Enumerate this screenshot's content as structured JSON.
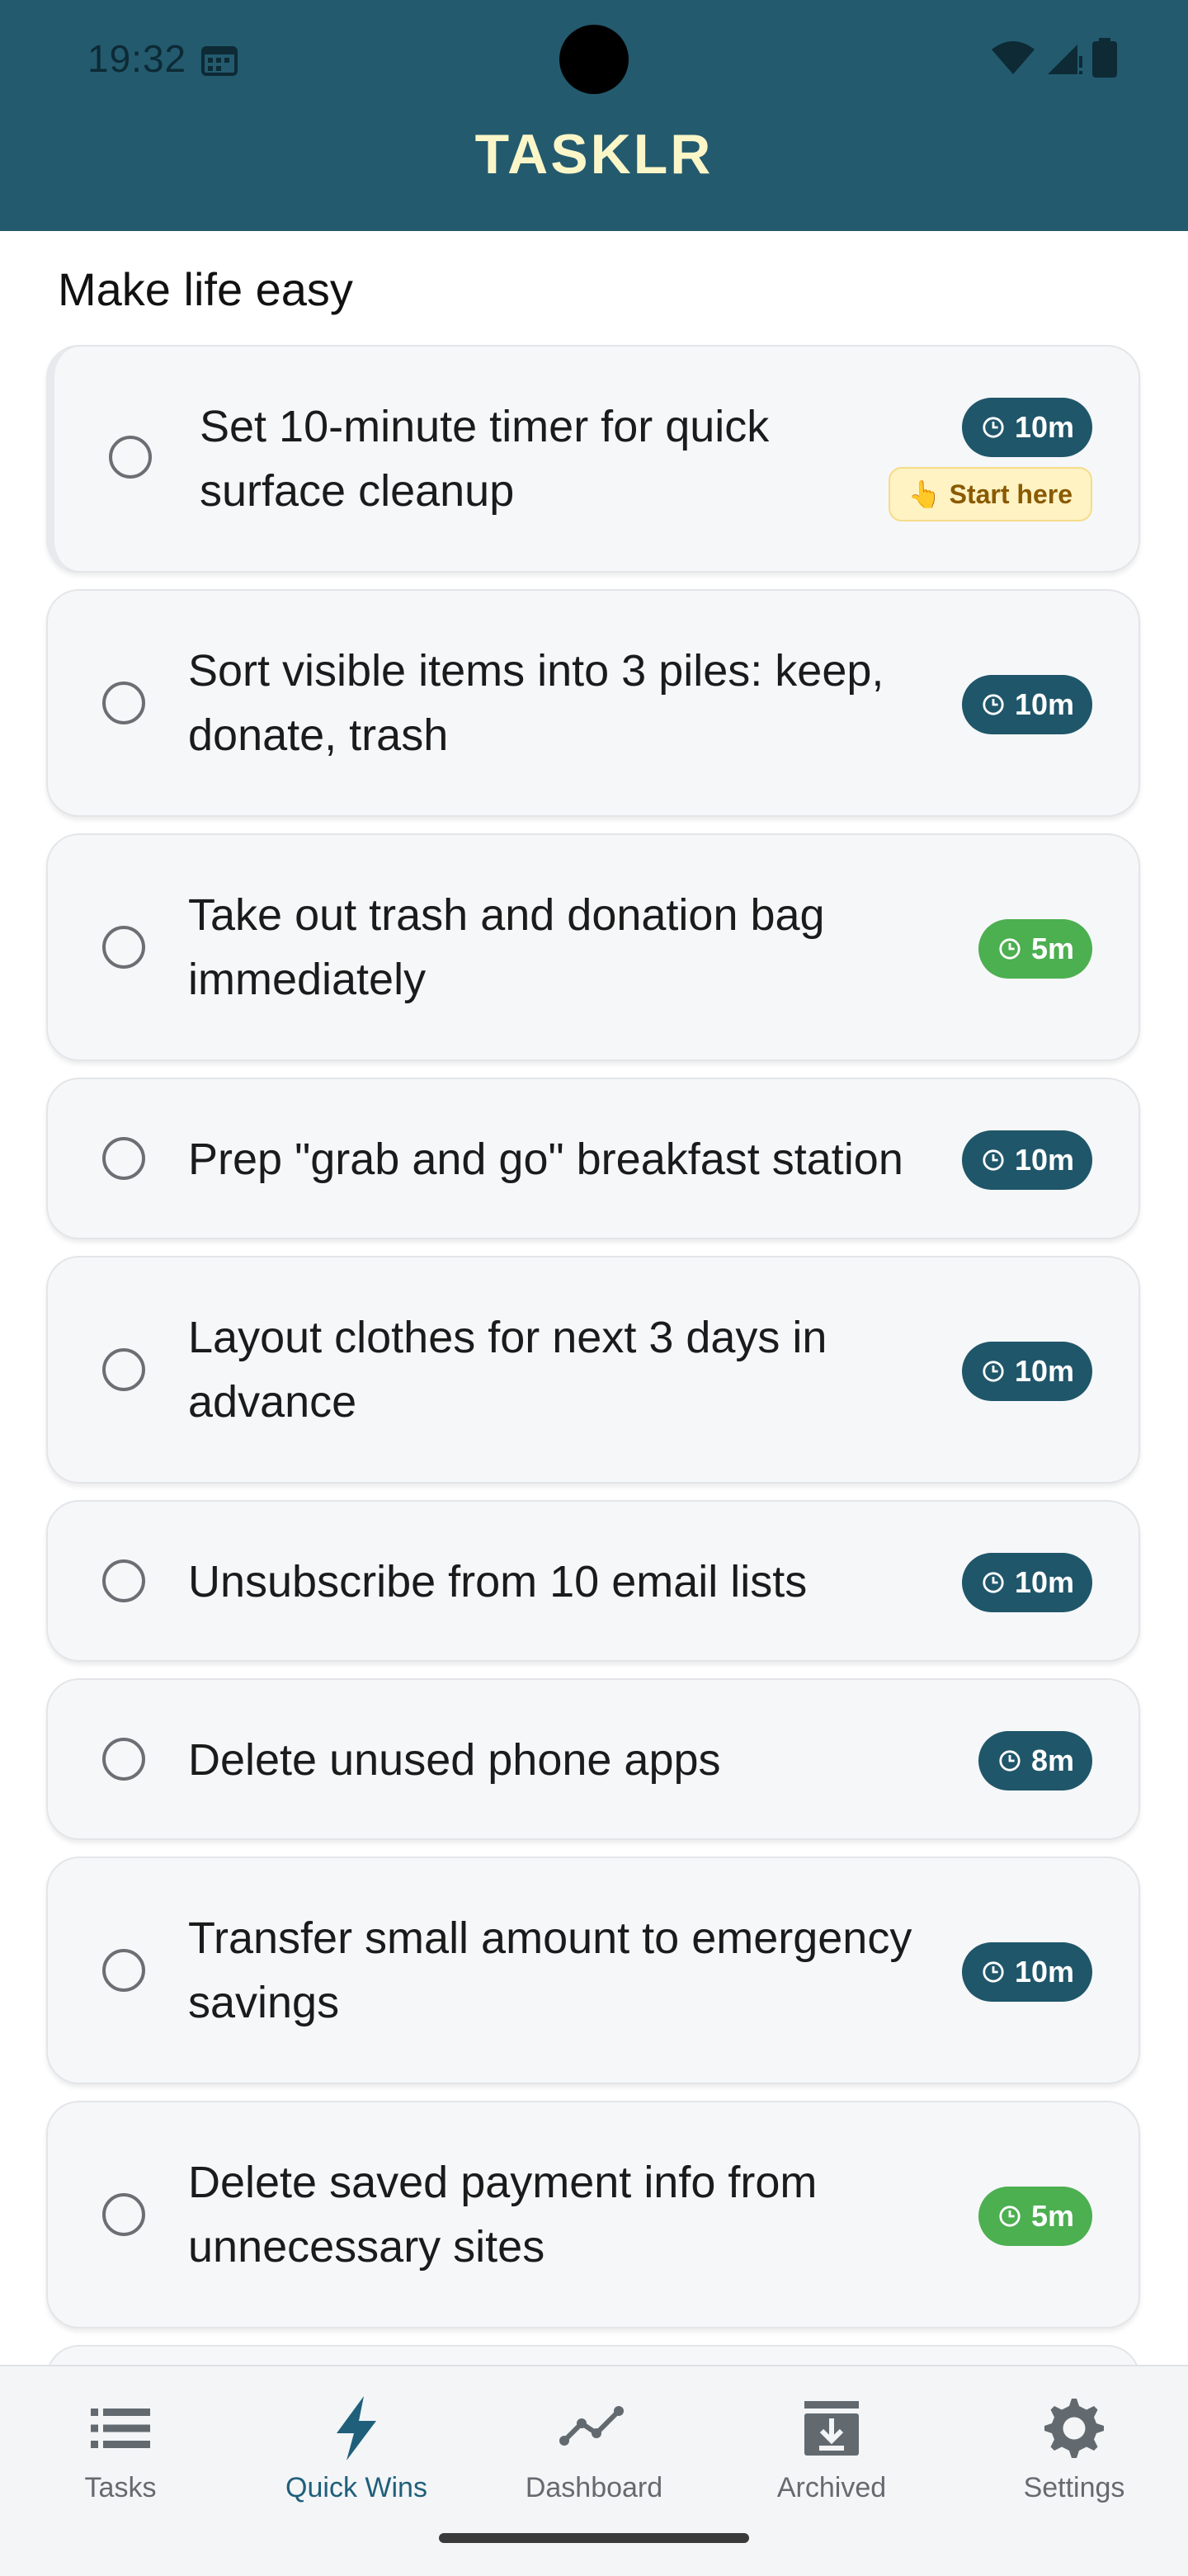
{
  "status_bar": {
    "time": "19:32"
  },
  "app": {
    "title": "TASKLR"
  },
  "section": {
    "title": "Make life easy"
  },
  "tasks": [
    {
      "text": "Set 10-minute timer for quick surface cleanup",
      "duration": "10m",
      "badge_color": "#1f566a",
      "hint": "Start here"
    },
    {
      "text": "Sort visible items into 3 piles: keep, donate, trash",
      "duration": "10m",
      "badge_color": "#1f566a"
    },
    {
      "text": "Take out trash and donation bag immediately",
      "duration": "5m",
      "badge_color": "#4caf50"
    },
    {
      "text": "Prep \"grab and go\" breakfast station",
      "duration": "10m",
      "badge_color": "#1f566a"
    },
    {
      "text": "Layout clothes for next 3 days in advance",
      "duration": "10m",
      "badge_color": "#1f566a"
    },
    {
      "text": "Unsubscribe from 10 email lists",
      "duration": "10m",
      "badge_color": "#1f566a"
    },
    {
      "text": "Delete unused phone apps",
      "duration": "8m",
      "badge_color": "#1f566a"
    },
    {
      "text": "Transfer small amount to emergency savings",
      "duration": "10m",
      "badge_color": "#1f566a"
    },
    {
      "text": "Delete saved payment info from unnecessary sites",
      "duration": "5m",
      "badge_color": "#4caf50"
    }
  ],
  "nav": {
    "items": [
      {
        "label": "Tasks",
        "icon": "list-icon"
      },
      {
        "label": "Quick Wins",
        "icon": "lightning-icon",
        "active": true
      },
      {
        "label": "Dashboard",
        "icon": "chart-line-icon"
      },
      {
        "label": "Archived",
        "icon": "archive-icon"
      },
      {
        "label": "Settings",
        "icon": "gear-icon"
      }
    ]
  },
  "colors": {
    "header": "#235a6e",
    "title": "#fbf6c8",
    "accent": "#1f566a",
    "green": "#4caf50"
  }
}
